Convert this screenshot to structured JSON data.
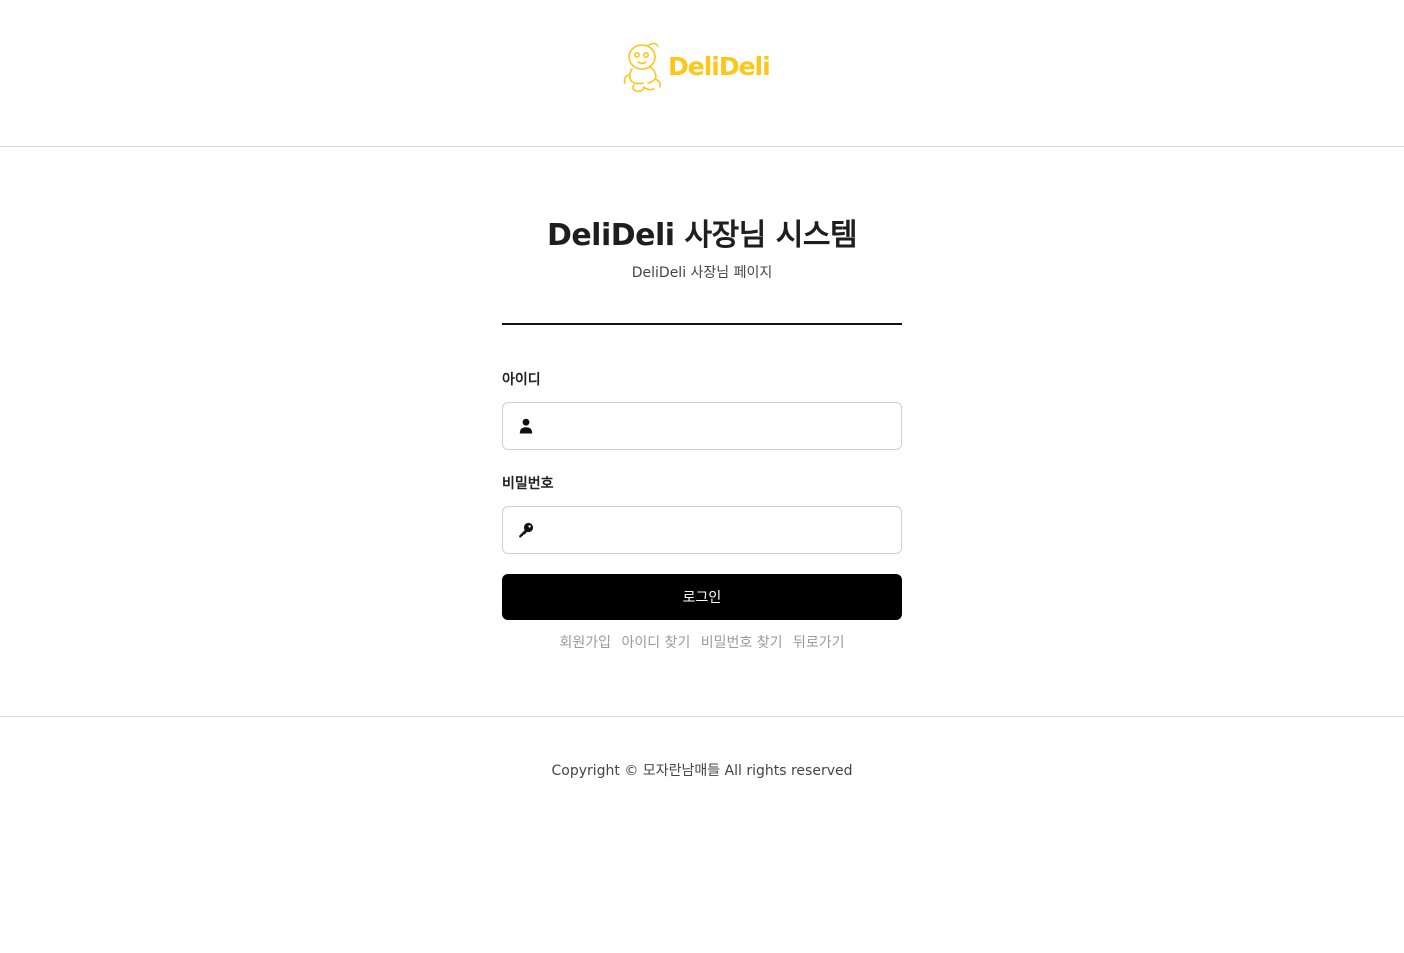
{
  "brand": {
    "name": "DeliDeli",
    "color": "#ffc61a"
  },
  "page": {
    "title": "DeliDeli 사장님 시스템",
    "subtitle": "DeliDeli 사장님 페이지"
  },
  "form": {
    "id_label": "아이디",
    "id_value": "",
    "password_label": "비밀번호",
    "password_value": "",
    "login_button": "로그인",
    "id_icon": "user-icon",
    "password_icon": "key-icon"
  },
  "links": [
    {
      "label": "회원가입"
    },
    {
      "label": "아이디 찾기"
    },
    {
      "label": "비밀번호 찾기"
    },
    {
      "label": "뒤로가기"
    }
  ],
  "footer": {
    "copyright": "Copyright © 모자란남매들 All rights reserved"
  }
}
